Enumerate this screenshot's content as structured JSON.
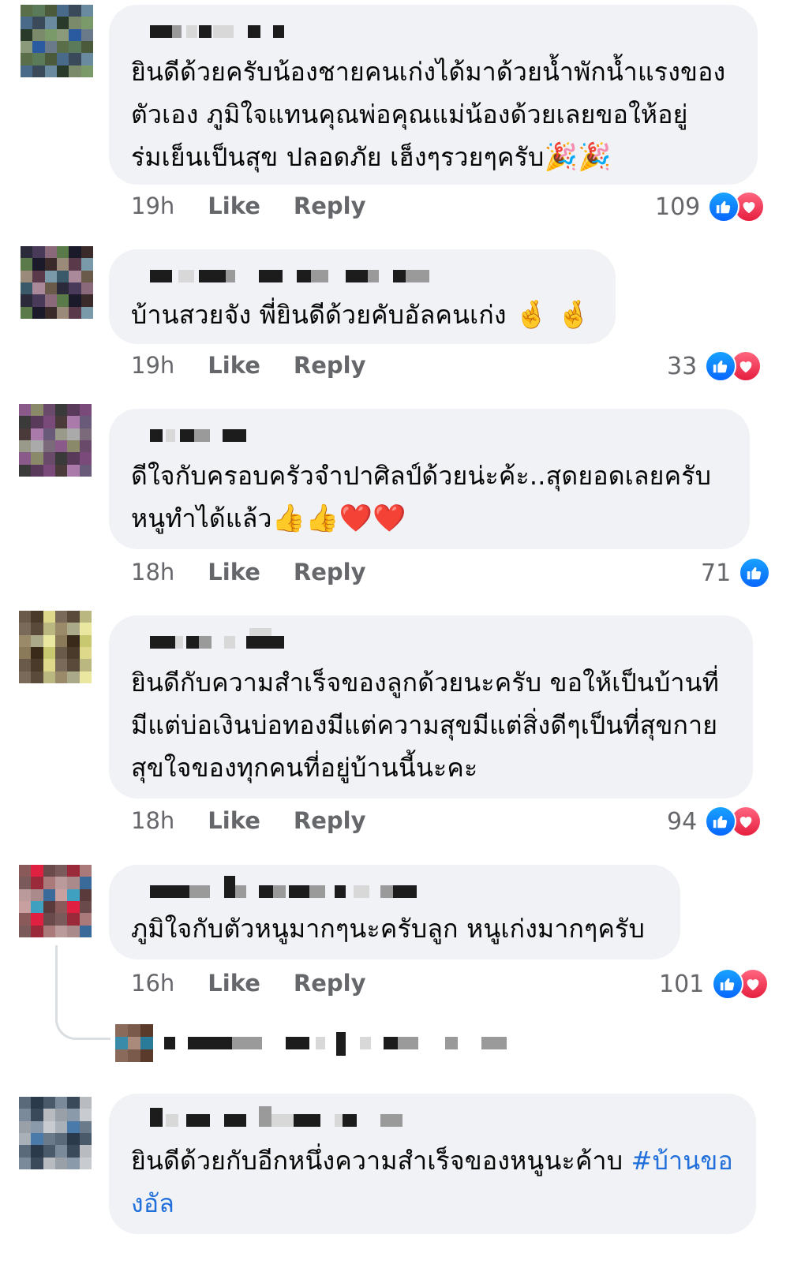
{
  "comments": [
    {
      "text": "ยินดีด้วยครับน้องชายคนเก่งได้มาด้วยน้ำพักน้ำแรงของ\nตัวเอง ภูมิใจแทนคุณพ่อคุณแม่น้องด้วยเลยขอให้อยู่\nร่มเย็นเป็นสุข ปลอดภัย เฮ็งๆรวยๆครับ",
      "emoji_tail": "🎉🎉",
      "time": "19h",
      "like": "Like",
      "reply": "Reply",
      "reaction_count": "109",
      "reactions": [
        "like-icon",
        "love-icon"
      ]
    },
    {
      "text": "บ้านสวยจัง พี่ยินดีด้วยคับอัลคนเก่ง ",
      "emoji_tail": "🤞 🤞",
      "time": "19h",
      "like": "Like",
      "reply": "Reply",
      "reaction_count": "33",
      "reactions": [
        "like-icon",
        "love-icon"
      ]
    },
    {
      "text": "ดีใจกับครอบครัวจำปาศิลป์ด้วยน่ะค้ะ..สุดยอดเลยครับ\nหนูทำได้แล้ว",
      "emoji_tail": "👍👍❤️❤️",
      "time": "18h",
      "like": "Like",
      "reply": "Reply",
      "reaction_count": "71",
      "reactions": [
        "like-icon"
      ]
    },
    {
      "text": "ยินดีกับความสำเร็จของลูกด้วยนะครับ ขอให้เป็นบ้านที่\nมีแต่บ่อเงินบ่อทองมีแต่ความสุขมีแต่สิ่งดีๆเป็นที่สุขกาย\nสุขใจของทุกคนที่อยู่บ้านนี้นะคะ",
      "emoji_tail": "",
      "time": "18h",
      "like": "Like",
      "reply": "Reply",
      "reaction_count": "94",
      "reactions": [
        "like-icon",
        "love-icon"
      ]
    },
    {
      "text": "ภูมิใจกับตัวหนูมากๆนะครับลูก หนูเก่งมากๆครับ",
      "emoji_tail": "",
      "time": "16h",
      "like": "Like",
      "reply": "Reply",
      "reaction_count": "101",
      "reactions": [
        "like-icon",
        "love-icon"
      ]
    },
    {
      "text": "ยินดีด้วยกับอีกหนึ่งความสำเร็จของหนูนะค้าบ ",
      "hashtag": "#บ้านขอ\nงอัล",
      "emoji_tail": ""
    }
  ],
  "colors": {
    "bubble": "#f0f2f5",
    "meta": "#65676b",
    "hashtag": "#216fdb",
    "like": "#0866ff",
    "love": "#e61e3f"
  }
}
